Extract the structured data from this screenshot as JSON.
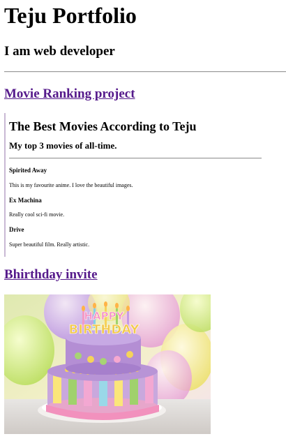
{
  "page": {
    "title": "Teju Portfolio",
    "subtitle": "I am web developer"
  },
  "projects": [
    {
      "link_text": "Movie Ranking project"
    },
    {
      "link_text": "Bhirthday invite"
    }
  ],
  "movie_page": {
    "title": "The Best Movies According to Teju",
    "subtitle": "My top 3 movies of all-time.",
    "movies": [
      {
        "name": "Spirited Away",
        "description": "This is my favourite anime. I love the beautiful images."
      },
      {
        "name": "Ex Machina",
        "description": "Really cool sci-fi movie."
      },
      {
        "name": "Drive",
        "description": "Super beautiful film. Really artistic."
      }
    ]
  },
  "birthday_image": {
    "topper_text": "HAPPY BIRTHDAY"
  },
  "colors": {
    "link": "#551a8b",
    "divider": "#9a9a9a"
  }
}
